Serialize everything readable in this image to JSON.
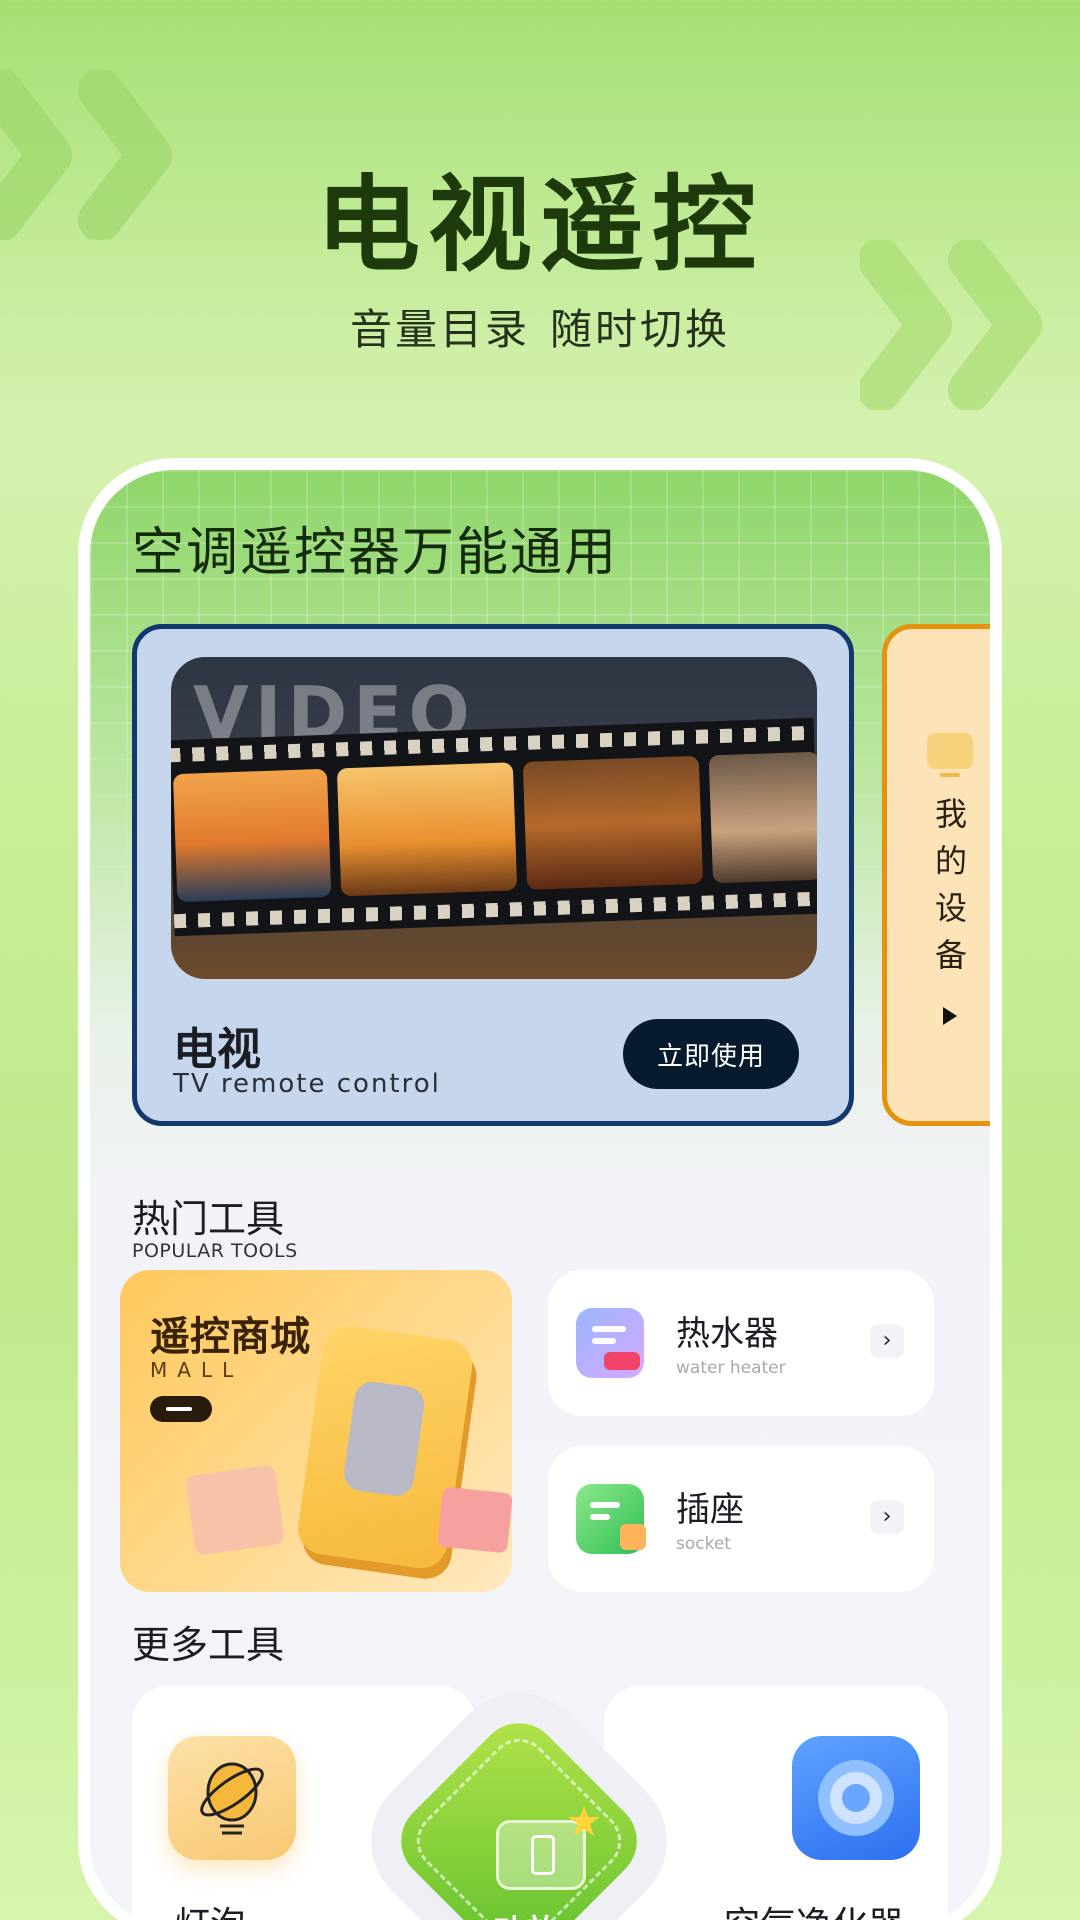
{
  "hero": {
    "title": "电视遥控",
    "subtitle_parts": [
      "音量目录",
      "随时切换"
    ]
  },
  "card": {
    "title": "空调遥控器万能通用",
    "tv": {
      "film_word": "VIDEO",
      "name": "电视",
      "name_en": "TV remote control",
      "button": "立即使用"
    },
    "my_devices": {
      "label_chars": [
        "我",
        "的",
        "设",
        "备"
      ]
    }
  },
  "popular": {
    "title": "热门工具",
    "subtitle": "POPULAR TOOLS",
    "mall": {
      "title": "遥控商城",
      "subtitle": "MALL"
    },
    "tools": [
      {
        "name": "热水器",
        "en": "water heater",
        "icon": "water-heater-icon"
      },
      {
        "name": "插座",
        "en": "socket",
        "icon": "socket-icon"
      }
    ],
    "arrow_glyph": "›"
  },
  "more": {
    "title": "更多工具",
    "items": [
      {
        "name": "灯泡",
        "icon": "bulb-icon"
      },
      {
        "name": "功放",
        "icon": "amplifier-icon"
      },
      {
        "name": "空气净化器",
        "icon": "air-purifier-icon"
      }
    ]
  },
  "colors": {
    "accent_green": "#5bbf2c",
    "tv_card_border": "#12386e",
    "device_card_border": "#e6920f",
    "button_dark": "#071a2e"
  }
}
